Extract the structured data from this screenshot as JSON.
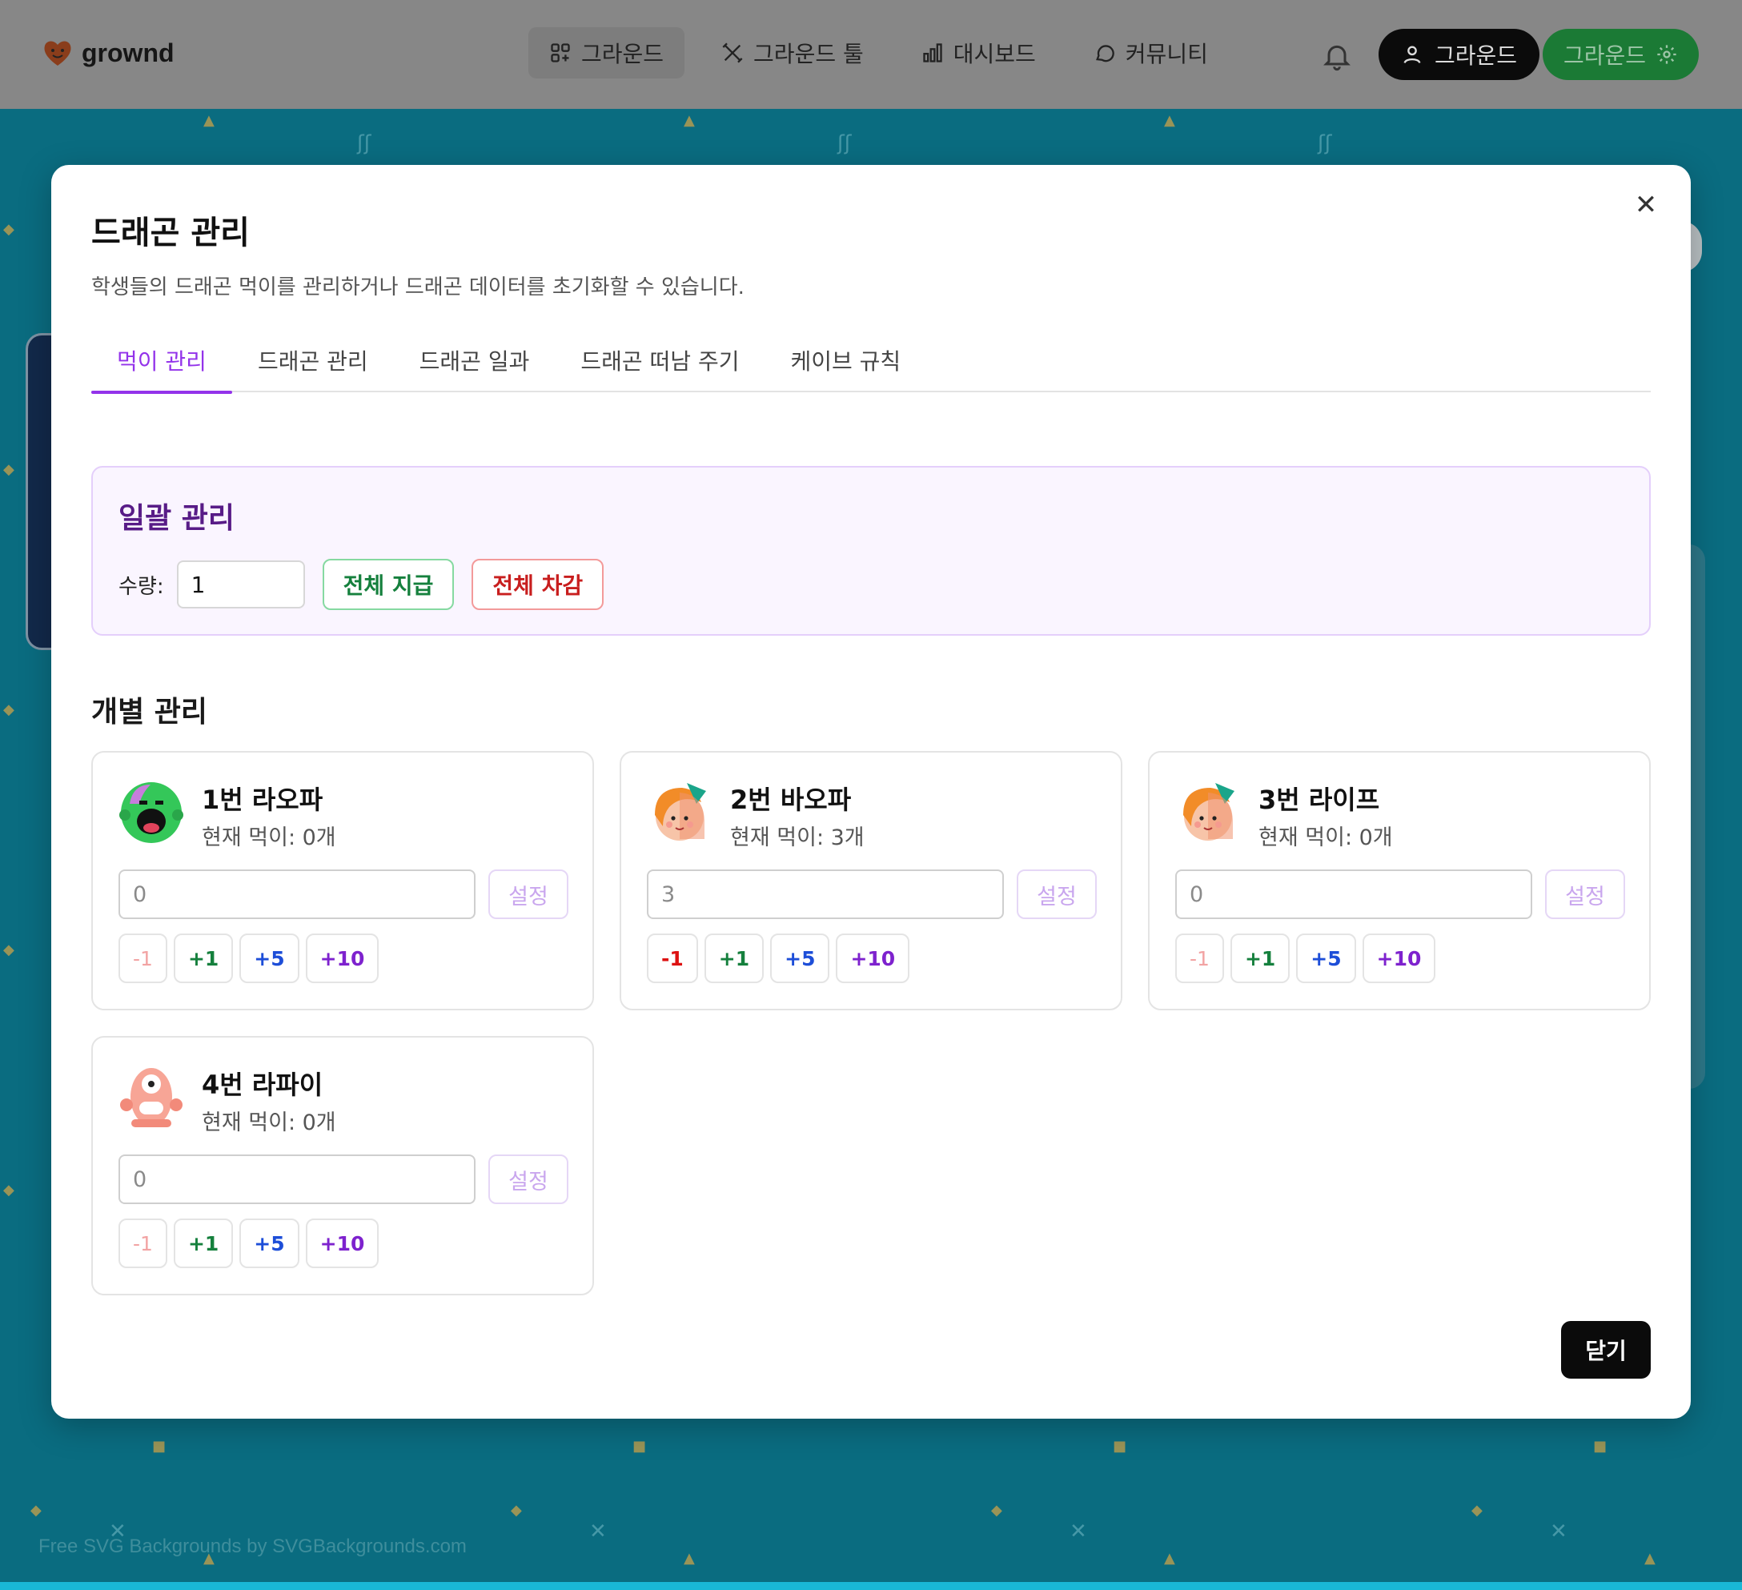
{
  "header": {
    "logo_text": "grownd",
    "nav": [
      {
        "label": "그라운드",
        "icon": "grid-plus-icon",
        "active": true
      },
      {
        "label": "그라운드 툴",
        "icon": "tools-icon",
        "active": false
      },
      {
        "label": "대시보드",
        "icon": "bar-chart-icon",
        "active": false
      },
      {
        "label": "커뮤니티",
        "icon": "chat-bubble-icon",
        "active": false
      }
    ],
    "notifications_icon": "bell-icon",
    "user_button_label": "그라운드",
    "ground_button_label": "그라운드"
  },
  "modal": {
    "title": "드래곤 관리",
    "description": "학생들의 드래곤 먹이를 관리하거나 드래곤 데이터를 초기화할 수 있습니다.",
    "tabs": [
      "먹이 관리",
      "드래곤 관리",
      "드래곤 일과",
      "드래곤 떠남 주기",
      "케이브 규칙"
    ],
    "active_tab": "먹이 관리",
    "bulk": {
      "title": "일괄 관리",
      "quantity_label": "수량:",
      "quantity_value": "1",
      "give_all_label": "전체 지급",
      "take_all_label": "전체 차감"
    },
    "individual_title": "개별 관리",
    "students": [
      {
        "name": "1번 라오파",
        "food": "현재 먹이: 0개",
        "input_value": "0",
        "set_label": "설정",
        "steps": [
          "-1",
          "+1",
          "+5",
          "+10"
        ],
        "avatar": "green-zombie-avatar"
      },
      {
        "name": "2번 바오파",
        "food": "현재 먹이: 3개",
        "input_value": "3",
        "set_label": "설정",
        "steps": [
          "-1",
          "+1",
          "+5",
          "+10"
        ],
        "avatar": "orange-hair-girl-avatar"
      },
      {
        "name": "3번 라이프",
        "food": "현재 먹이: 0개",
        "input_value": "0",
        "set_label": "설정",
        "steps": [
          "-1",
          "+1",
          "+5",
          "+10"
        ],
        "avatar": "orange-hair-girl-avatar"
      },
      {
        "name": "4번 라파이",
        "food": "현재 먹이: 0개",
        "input_value": "0",
        "set_label": "설정",
        "steps": [
          "-1",
          "+1",
          "+5",
          "+10"
        ],
        "avatar": "pink-cyclops-avatar"
      }
    ],
    "close_label": "닫기"
  },
  "background": {
    "credit": "Free SVG Backgrounds by SVGBackgrounds.com"
  },
  "colors": {
    "accent": "#9333ea",
    "bulk_bg": "#faf5ff",
    "give": "#15803d",
    "take": "#c81e1e",
    "page_bg": "#0a6c80"
  }
}
